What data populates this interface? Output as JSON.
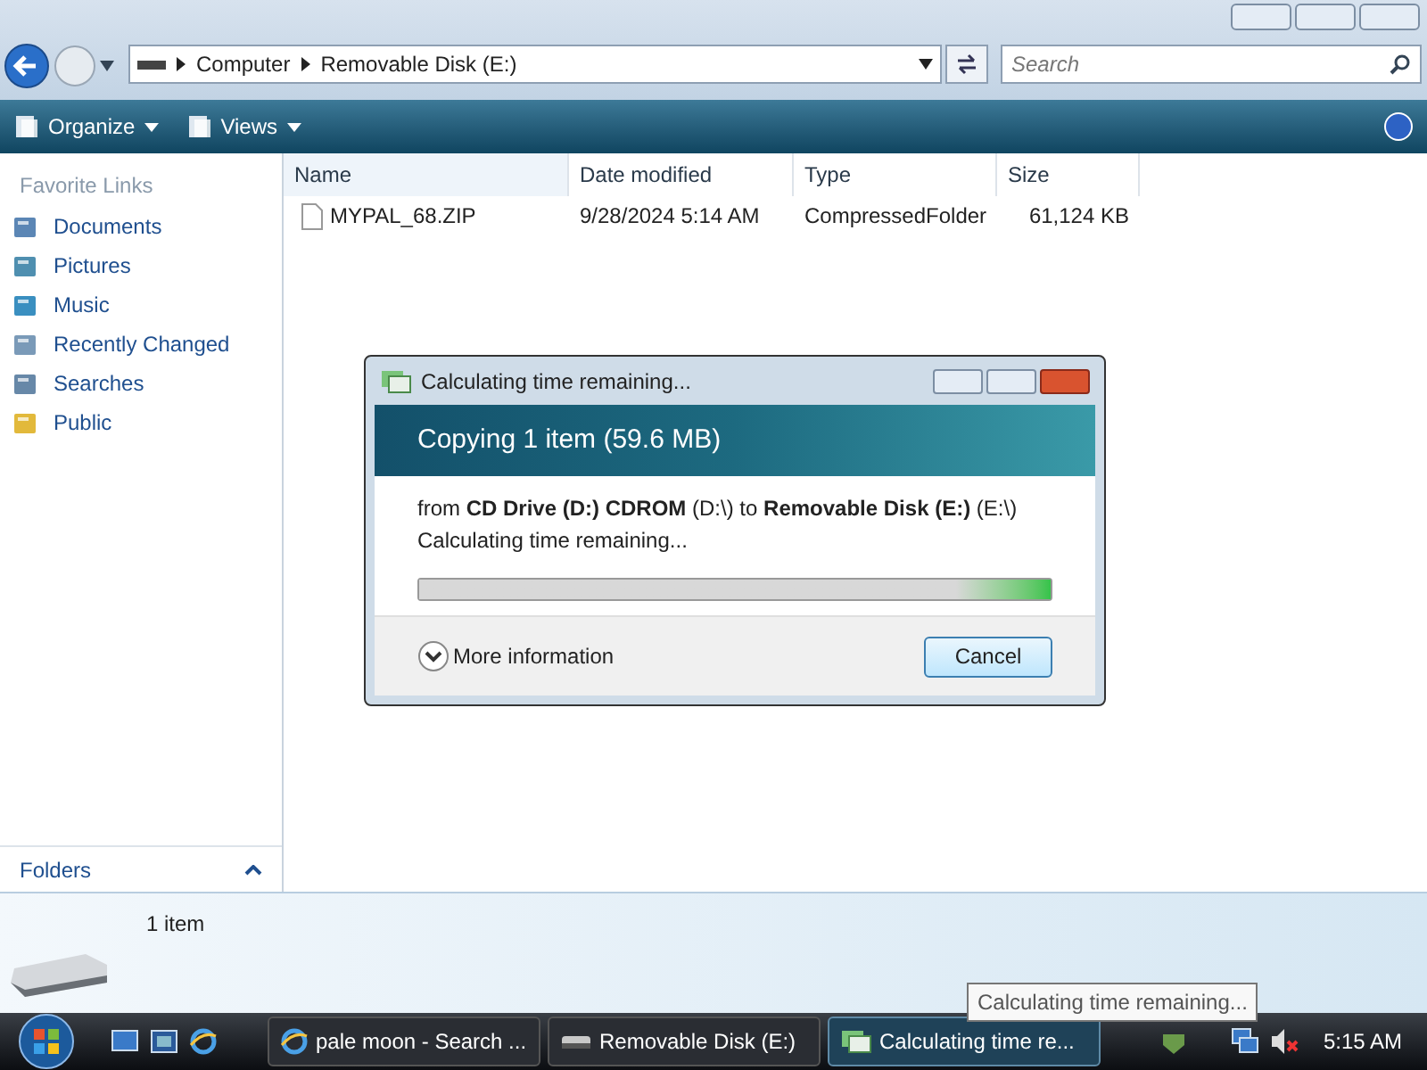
{
  "address": {
    "crumbs": [
      "Computer",
      "Removable Disk (E:)"
    ]
  },
  "search": {
    "placeholder": "Search"
  },
  "toolbar": [
    "Organize",
    "Views"
  ],
  "sidebar": {
    "title": "Favorite Links",
    "items": [
      {
        "label": "Documents",
        "kind": "documents"
      },
      {
        "label": "Pictures",
        "kind": "pictures"
      },
      {
        "label": "Music",
        "kind": "music"
      },
      {
        "label": "Recently Changed",
        "kind": "recent"
      },
      {
        "label": "Searches",
        "kind": "searches"
      },
      {
        "label": "Public",
        "kind": "folder"
      }
    ],
    "folders": "Folders"
  },
  "table": {
    "columns": [
      "Name",
      "Date modified",
      "Type",
      "Size"
    ],
    "rows": [
      [
        "MYPAL_68.ZIP",
        "9/28/2024 5:14 AM",
        "CompressedFolder",
        "61,124 KB"
      ]
    ]
  },
  "details": {
    "count": "1 item"
  },
  "dialog": {
    "title": "Calculating time remaining...",
    "heading": "Copying 1 item (59.6 MB)",
    "from": "from **CD Drive (D:) CDROM** (D:\\) to **Removable Disk (E:)** (E:\\)",
    "status": "Calculating time remaining...",
    "progress": {
      "level": 1
    },
    "more": "More information",
    "cancel": "Cancel"
  },
  "tooltip": "Calculating time remaining...",
  "taskbar": {
    "buttons": [
      {
        "label": "pale moon - Search ...",
        "kind": "browser",
        "selected": false
      },
      {
        "label": "Removable Disk (E:)",
        "kind": "drive",
        "selected": false
      },
      {
        "label": "Calculating time re...",
        "kind": "copy",
        "selected": true
      }
    ],
    "clock": "5:15 AM"
  }
}
